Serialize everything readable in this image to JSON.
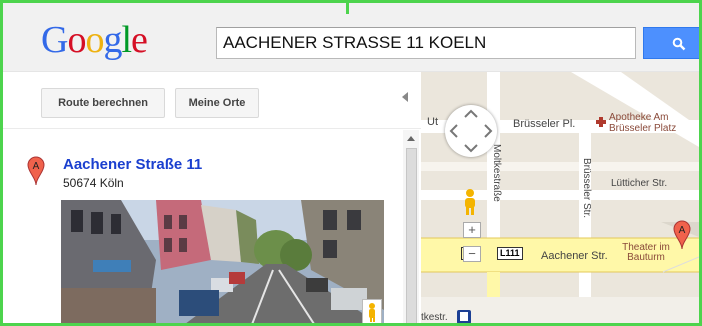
{
  "header": {
    "logo": {
      "G": "G",
      "o1": "o",
      "o2": "o",
      "g": "g",
      "l": "l",
      "e": "e"
    },
    "search": {
      "value": "AACHENER STRASSE 11 KOELN"
    },
    "search_button": {
      "icon": "search-icon"
    }
  },
  "sidebar": {
    "route_button": "Route berechnen",
    "places_button": "Meine Orte",
    "result": {
      "marker": "A",
      "title": "Aachener Straße 11",
      "address": "50674 Köln"
    }
  },
  "map": {
    "labels": {
      "bruesseler_pl": "Brüsseler Pl.",
      "apotheke": "Apotheke Am Brüsseler Platz",
      "moltkestrasse": "Moltkestraße",
      "bruesseler_str": "Brüsseler Str.",
      "luetticher": "Lütticher Str.",
      "aachener": "Aachener Str.",
      "theater": "Theater im Bauturm",
      "ut": "Ut",
      "road55": "55",
      "l111": "L111",
      "tkestr": "tkestr."
    },
    "marker": "A"
  }
}
